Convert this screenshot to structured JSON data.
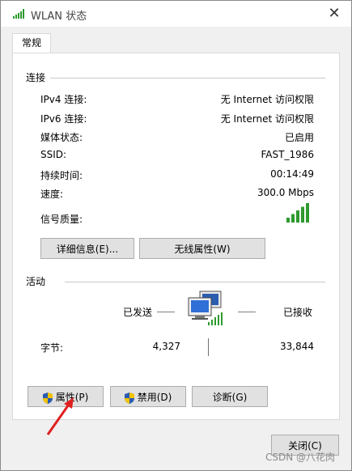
{
  "window": {
    "title": "WLAN 状态",
    "close_glyph": "✕"
  },
  "tabs": [
    {
      "label": "常规"
    }
  ],
  "connection": {
    "section_label": "连接",
    "rows": [
      {
        "label": "IPv4 连接:",
        "value": "无 Internet 访问权限"
      },
      {
        "label": "IPv6 连接:",
        "value": "无 Internet 访问权限"
      },
      {
        "label": "媒体状态:",
        "value": "已启用"
      },
      {
        "label": "SSID:",
        "value": "FAST_1986"
      },
      {
        "label": "持续时间:",
        "value": "00:14:49"
      },
      {
        "label": "速度:",
        "value": "300.0 Mbps"
      }
    ],
    "signal_label": "信号质量:",
    "signal_bars": 5,
    "signal_max": 5,
    "details_button": "详细信息(E)...",
    "wireless_props_button": "无线属性(W)"
  },
  "activity": {
    "section_label": "活动",
    "sent_label": "已发送",
    "received_label": "已接收",
    "bytes_label": "字节:",
    "bytes_sent": "4,327",
    "bytes_received": "33,844"
  },
  "buttons": {
    "properties": "属性(P)",
    "disable": "禁用(D)",
    "diagnose": "诊断(G)",
    "close": "关闭(C)"
  },
  "watermark": "CSDN @八花肉",
  "colors": {
    "signal_green": "#2e9a2e",
    "shield_blue": "#2a5db0",
    "shield_yellow": "#f2c200",
    "annotation_red": "#e02020"
  }
}
